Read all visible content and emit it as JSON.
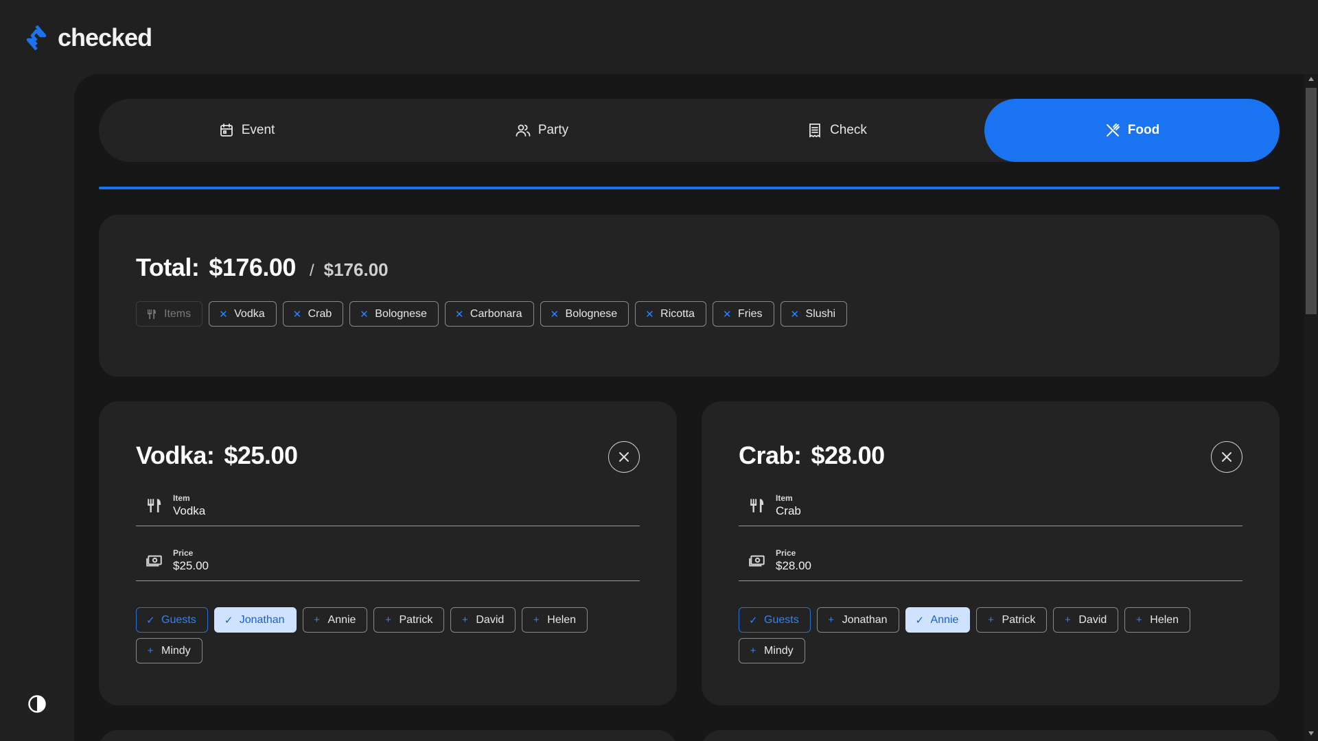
{
  "app": {
    "name": "checked",
    "accent": "#1a73f0"
  },
  "tabs": [
    {
      "label": "Event",
      "icon": "calendar-icon",
      "active": false
    },
    {
      "label": "Party",
      "icon": "users-icon",
      "active": false
    },
    {
      "label": "Check",
      "icon": "receipt-icon",
      "active": false
    },
    {
      "label": "Food",
      "icon": "utensils-crossed-icon",
      "active": true
    }
  ],
  "progress": 1.0,
  "summary": {
    "total_label": "Total:",
    "total_amount": "$176.00",
    "separator": "/",
    "total_max": "$176.00",
    "items_label": "Items",
    "items": [
      "Vodka",
      "Crab",
      "Bolognese",
      "Carbonara",
      "Bolognese",
      "Ricotta",
      "Fries",
      "Slushi"
    ]
  },
  "cards": [
    {
      "title_name": "Vodka:",
      "title_price": "$25.00",
      "item_label": "Item",
      "item_value": "Vodka",
      "price_label": "Price",
      "price_value": "$25.00",
      "guests_label": "Guests",
      "people": [
        {
          "name": "Jonathan",
          "selected": true
        },
        {
          "name": "Annie",
          "selected": false
        },
        {
          "name": "Patrick",
          "selected": false
        },
        {
          "name": "David",
          "selected": false
        },
        {
          "name": "Helen",
          "selected": false
        },
        {
          "name": "Mindy",
          "selected": false
        }
      ]
    },
    {
      "title_name": "Crab:",
      "title_price": "$28.00",
      "item_label": "Item",
      "item_value": "Crab",
      "price_label": "Price",
      "price_value": "$28.00",
      "guests_label": "Guests",
      "people": [
        {
          "name": "Jonathan",
          "selected": false
        },
        {
          "name": "Annie",
          "selected": true
        },
        {
          "name": "Patrick",
          "selected": false
        },
        {
          "name": "David",
          "selected": false
        },
        {
          "name": "Helen",
          "selected": false
        },
        {
          "name": "Mindy",
          "selected": false
        }
      ]
    }
  ]
}
